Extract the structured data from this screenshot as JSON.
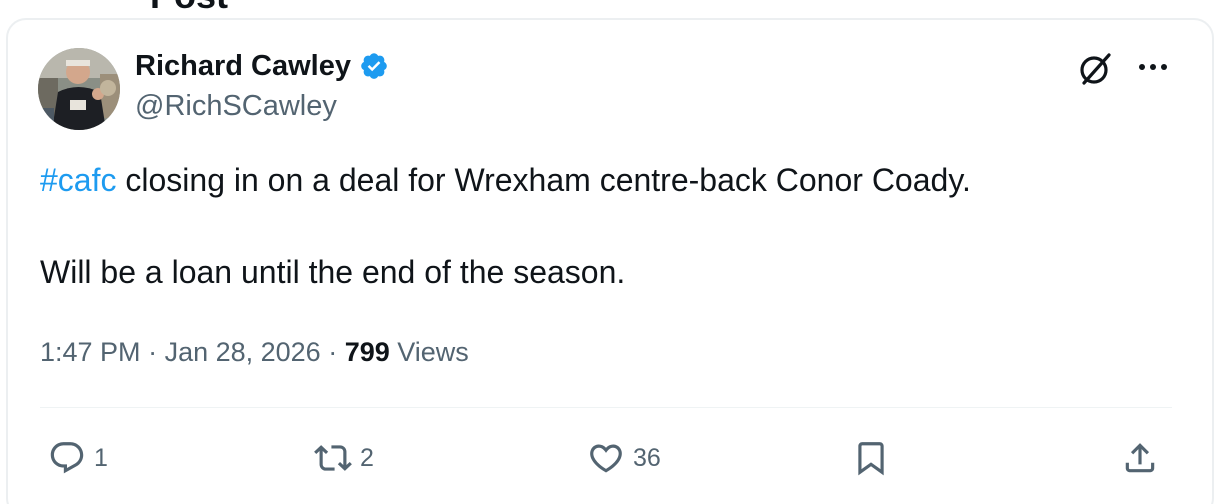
{
  "page": {
    "heading": "Post"
  },
  "author": {
    "name": "Richard Cawley",
    "handle": "@RichSCawley",
    "verified": true,
    "verified_color": "#1d9bf0",
    "avatar_icon": "profile-photo"
  },
  "header_actions": {
    "grok_icon": "grok-icon",
    "more_icon": "more-dots-icon"
  },
  "tweet": {
    "hashtag": "#cafc",
    "line1_rest": " closing in on a deal for Wrexham centre-back Conor Coady.",
    "line2": "Will be a loan until the end of the season.",
    "hashtag_color": "#1d9bf0"
  },
  "meta": {
    "time": "1:47 PM",
    "separator": " · ",
    "date": "Jan 28, 2026",
    "views_count": "799",
    "views_label": " Views"
  },
  "actions": {
    "reply": {
      "icon": "reply-icon",
      "count": "1"
    },
    "repost": {
      "icon": "repost-icon",
      "count": "2"
    },
    "like": {
      "icon": "heart-icon",
      "count": "36"
    },
    "bookmark": {
      "icon": "bookmark-icon"
    },
    "share": {
      "icon": "share-icon"
    }
  },
  "colors": {
    "text_primary": "#0f1419",
    "text_secondary": "#536471",
    "accent": "#1d9bf0",
    "border": "#eff3f4"
  }
}
